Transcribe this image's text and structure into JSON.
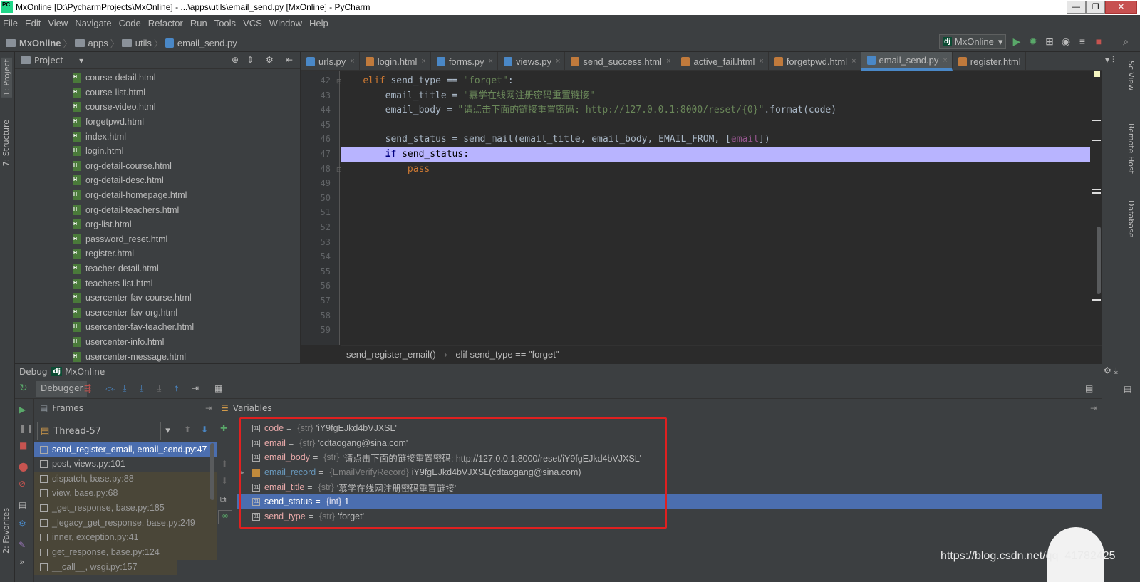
{
  "window": {
    "title": "MxOnline [D:\\PycharmProjects\\MxOnline] - ...\\apps\\utils\\email_send.py [MxOnline] - PyCharm",
    "icon_text": "PC",
    "minimize": "—",
    "maximize": "❐",
    "close": "✕"
  },
  "menu": [
    "File",
    "Edit",
    "View",
    "Navigate",
    "Code",
    "Refactor",
    "Run",
    "Tools",
    "VCS",
    "Window",
    "Help"
  ],
  "breadcrumbs": [
    "MxOnline",
    "apps",
    "utils",
    "email_send.py"
  ],
  "run_config": {
    "badge": "dj",
    "label": "MxOnline",
    "arrow": "▾"
  },
  "left_tabs": {
    "project": "1: Project",
    "structure": "7: Structure",
    "favorites": "2: Favorites"
  },
  "right_tabs": {
    "sciview": "SciView",
    "remote": "Remote Host",
    "database": "Database"
  },
  "project_panel": {
    "title": "Project",
    "files": [
      "course-detail.html",
      "course-list.html",
      "course-video.html",
      "forgetpwd.html",
      "index.html",
      "login.html",
      "org-detail-course.html",
      "org-detail-desc.html",
      "org-detail-homepage.html",
      "org-detail-teachers.html",
      "org-list.html",
      "password_reset.html",
      "register.html",
      "teacher-detail.html",
      "teachers-list.html",
      "usercenter-fav-course.html",
      "usercenter-fav-org.html",
      "usercenter-fav-teacher.html",
      "usercenter-info.html",
      "usercenter-message.html"
    ]
  },
  "editor": {
    "tabs": [
      {
        "label": "urls.py",
        "color": "#4a88c7"
      },
      {
        "label": "login.html",
        "color": "#c07a3c"
      },
      {
        "label": "forms.py",
        "color": "#4a88c7"
      },
      {
        "label": "views.py",
        "color": "#4a88c7"
      },
      {
        "label": "send_success.html",
        "color": "#c07a3c"
      },
      {
        "label": "active_fail.html",
        "color": "#c07a3c"
      },
      {
        "label": "forgetpwd.html",
        "color": "#c07a3c"
      },
      {
        "label": "email_send.py",
        "color": "#4a88c7",
        "active": true
      },
      {
        "label": "register.html",
        "color": "#c07a3c"
      }
    ],
    "tab_close": "×",
    "line_numbers": [
      "42",
      "43",
      "44",
      "45",
      "46",
      "47",
      "48",
      "49",
      "50",
      "51",
      "52",
      "53",
      "54",
      "55",
      "56",
      "57",
      "58",
      "59"
    ],
    "highlighted_line": "47",
    "code": {
      "l42_kw": "elif",
      "l42_rest": " send_type == ",
      "l42_str": "\"forget\"",
      "l42_end": ":",
      "l43_a": "email_title = ",
      "l43_str": "\"慕学在线网注册密码重置链接\"",
      "l44_a": "email_body = ",
      "l44_str": "\"请点击下面的链接重置密码: http://127.0.0.1:8000/reset/{0}\"",
      "l44_end": ".format(code)",
      "l46_a": "send_status = send_mail(email_title, email_body, EMAIL_FROM, [",
      "l46_self": "email",
      "l46_end": "])",
      "l47_kw": "if",
      "l47_rest": " send_status:",
      "l48_kw": "pass"
    },
    "breadcrumb": [
      "send_register_email()",
      "elif send_type == \"forget\""
    ],
    "breadcrumb_sep": "›"
  },
  "debug": {
    "title": "Debug",
    "config": "MxOnline",
    "tab": "Debugger",
    "frames_title": "Frames",
    "variables_title": "Variables",
    "thread": "Thread-57",
    "frames": [
      {
        "label": "send_register_email, email_send.py:47",
        "kind": "sel"
      },
      {
        "label": "post, views.py:101",
        "kind": "usr"
      },
      {
        "label": "dispatch, base.py:88",
        "kind": "lib"
      },
      {
        "label": "view, base.py:68",
        "kind": "lib"
      },
      {
        "label": "_get_response, base.py:185",
        "kind": "lib"
      },
      {
        "label": "_legacy_get_response, base.py:249",
        "kind": "lib"
      },
      {
        "label": "inner, exception.py:41",
        "kind": "lib"
      },
      {
        "label": "get_response, base.py:124",
        "kind": "lib"
      },
      {
        "label": "__call__, wsgi.py:157",
        "kind": "lib"
      }
    ],
    "variables": [
      {
        "name": "code",
        "type": "{str}",
        "value": "'iY9fgEJkd4bVJXSL'"
      },
      {
        "name": "email",
        "type": "{str}",
        "value": "'cdtaogang@sina.com'"
      },
      {
        "name": "email_body",
        "type": "{str}",
        "value": "'请点击下面的链接重置密码: http://127.0.0.1:8000/reset/iY9fgEJkd4bVJXSL'"
      },
      {
        "name": "email_record",
        "type": "{EmailVerifyRecord}",
        "value": "iY9fgEJkd4bVJXSL(cdtaogang@sina.com)",
        "expandable": true
      },
      {
        "name": "email_title",
        "type": "{str}",
        "value": "'慕学在线网注册密码重置链接'"
      },
      {
        "name": "send_status",
        "type": "{int}",
        "value": "1",
        "selected": true
      },
      {
        "name": "send_type",
        "type": "{str}",
        "value": "'forget'"
      }
    ],
    "eq": "="
  },
  "watermark": "https://blog.csdn.net/qq_41782425"
}
